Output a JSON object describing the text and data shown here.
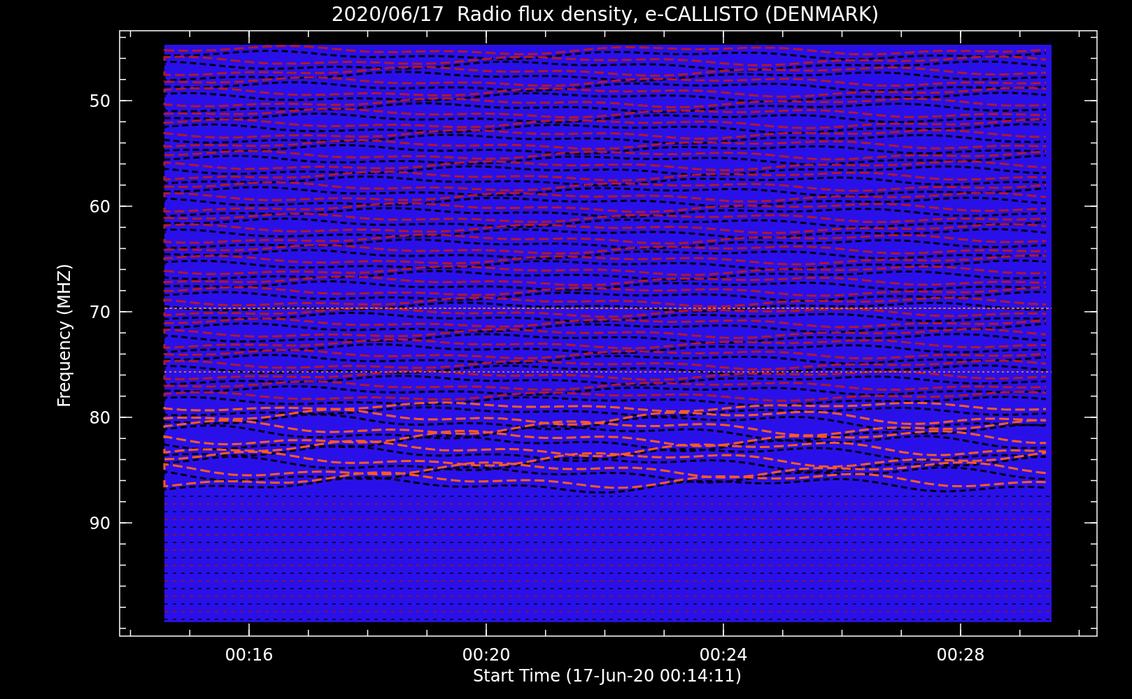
{
  "plot": {
    "title": "2020/06/17  Radio flux density, e-CALLISTO (DENMARK)",
    "y_axis": {
      "label": "Frequency (MHZ)",
      "ticks": [
        "50",
        "60",
        "70",
        "80",
        "90"
      ]
    },
    "x_axis": {
      "label": "Start Time (17-Jun-20 00:14:11)",
      "ticks": [
        "00:16",
        "00:20",
        "00:24",
        "00:28"
      ]
    }
  }
}
